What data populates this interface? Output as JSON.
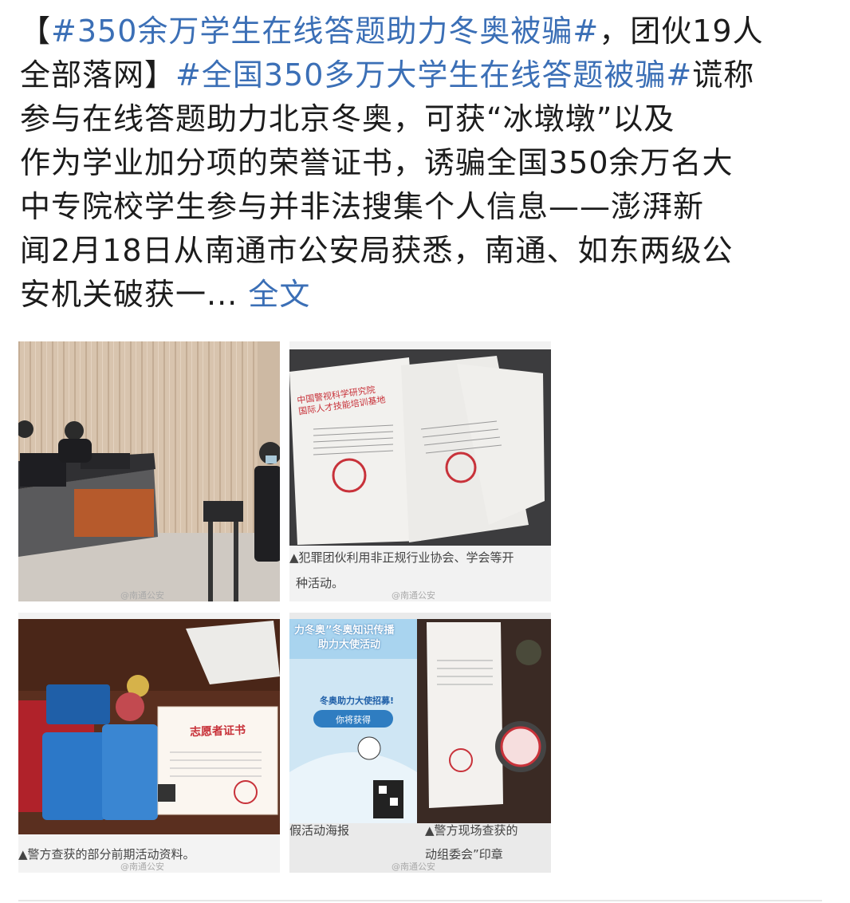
{
  "post": {
    "text_lines": [
      {
        "prefix": "【",
        "link": "#350余万学生在线答题助力冬奥被骗#",
        "suffix": "，团伙19人"
      },
      {
        "prefix": "全部落网】",
        "link": "#全国350多万大学生在线答题被骗#",
        "suffix": "谎称"
      },
      {
        "prefix": "参与在线答题助力北京冬奥，可获“冰墩墩”以及",
        "link": "",
        "suffix": ""
      },
      {
        "prefix": "作为学业加分项的荣誉证书，诱骗全国350余万名大",
        "link": "",
        "suffix": ""
      },
      {
        "prefix": "中专院校学生参与并非法搜集个人信息——澎湃新",
        "link": "",
        "suffix": ""
      },
      {
        "prefix": "闻2月18日从南通市公安局获悉，南通、如东两级公",
        "link": "",
        "suffix": ""
      },
      {
        "prefix": "安机关破获一...",
        "link": "",
        "suffix": ""
      }
    ],
    "more_label": "全文"
  },
  "images": [
    {
      "caption": "",
      "watermark": "@南通公安",
      "header_lines": []
    },
    {
      "caption": "▲犯罪团伙利用非正规行业协会、学会等开",
      "caption2": "种活动。",
      "watermark": "@南通公安",
      "doc_header": [
        "中国警视科学研究院",
        "国际人才技能培训基地"
      ]
    },
    {
      "caption": "▲警方查获的部分前期活动资料。",
      "watermark": "@南通公安",
      "certificate_title": "志愿者证书"
    },
    {
      "caption": "假活动海报",
      "caption_right": "▲警方现场查获的",
      "caption_right2": "动组委会”印章",
      "watermark": "@南通公安",
      "poster_lines": [
        "力冬奥”冬奥知识传播",
        "助力大使活动",
        "冬奥助力大使招募!",
        "你将获得"
      ]
    }
  ],
  "colors": {
    "link": "#3b6fb6",
    "text": "#1c1c1c",
    "seal_red": "#c8323a"
  }
}
